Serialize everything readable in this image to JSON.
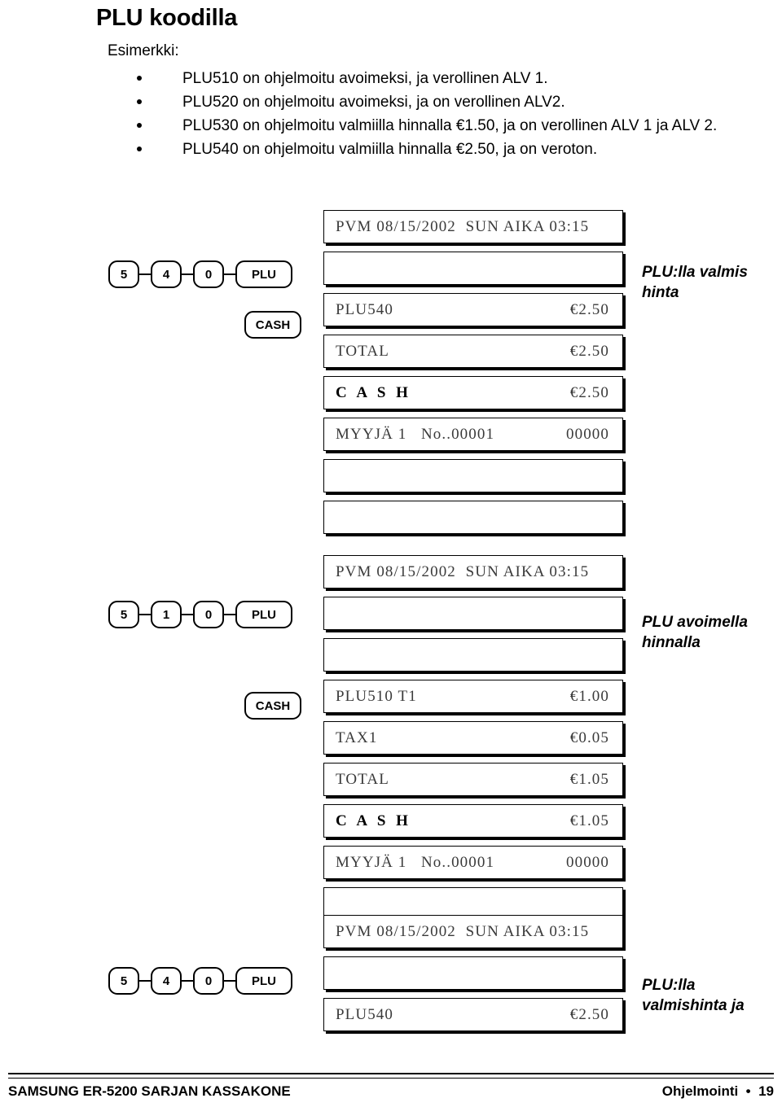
{
  "page": {
    "title": "PLU koodilla",
    "intro_label": "Esimerkki:",
    "bullets": [
      "PLU510 on ohjelmoitu avoimeksi, ja verollinen ALV 1.",
      "PLU520 on ohjelmoitu avoimeksi, ja on verollinen ALV2.",
      "PLU530 on ohjelmoitu valmiilla hinnalla €1.50, ja on verollinen ALV 1 ja ALV 2.",
      "PLU540 on ohjelmoitu valmiilla hinnalla €2.50, ja on veroton."
    ]
  },
  "groups": [
    {
      "keys": [
        "5",
        "4",
        "0",
        "PLU"
      ],
      "extra_key": "CASH",
      "annotation_line1": "PLU:lla valmis",
      "annotation_line2": "hinta",
      "lines": [
        {
          "left": "PVM 08/15/2002  SUN AIKA 03:15",
          "right": ""
        },
        {
          "left": "",
          "right": ""
        },
        {
          "left": "PLU540",
          "right": "€2.50"
        },
        {
          "left": "TOTAL",
          "right": "€2.50"
        },
        {
          "left": "C A S H",
          "right": "€2.50",
          "bold": true
        },
        {
          "left": "MYYJÄ 1   No..00001",
          "right": "00000"
        },
        {
          "left": "",
          "right": ""
        },
        {
          "left": "",
          "right": ""
        }
      ]
    },
    {
      "keys": [
        "5",
        "1",
        "0",
        "PLU"
      ],
      "extra_key": "CASH",
      "annotation_line1": "PLU avoimella",
      "annotation_line2": "hinnalla",
      "lines": [
        {
          "left": "PVM 08/15/2002  SUN AIKA 03:15",
          "right": ""
        },
        {
          "left": "",
          "right": ""
        },
        {
          "left": "",
          "right": ""
        },
        {
          "left": "PLU510 T1",
          "right": "€1.00"
        },
        {
          "left": "TAX1",
          "right": "€0.05"
        },
        {
          "left": "TOTAL",
          "right": "€1.05"
        },
        {
          "left": "C A S H",
          "right": "€1.05",
          "bold": true
        },
        {
          "left": "MYYJÄ 1   No..00001",
          "right": "00000"
        },
        {
          "left": "",
          "right": ""
        }
      ]
    },
    {
      "keys": [
        "5",
        "4",
        "0",
        "PLU"
      ],
      "extra_key": null,
      "annotation_line1": "PLU:lla",
      "annotation_line2": "valmishinta ja",
      "lines": [
        {
          "left": "PVM 08/15/2002  SUN AIKA 03:15",
          "right": ""
        },
        {
          "left": "",
          "right": ""
        },
        {
          "left": "PLU540",
          "right": "€2.50"
        }
      ]
    }
  ],
  "footer": {
    "left": "SAMSUNG ER-5200 SARJAN KASSAKONE",
    "right": "Ohjelmointi  •  19"
  }
}
